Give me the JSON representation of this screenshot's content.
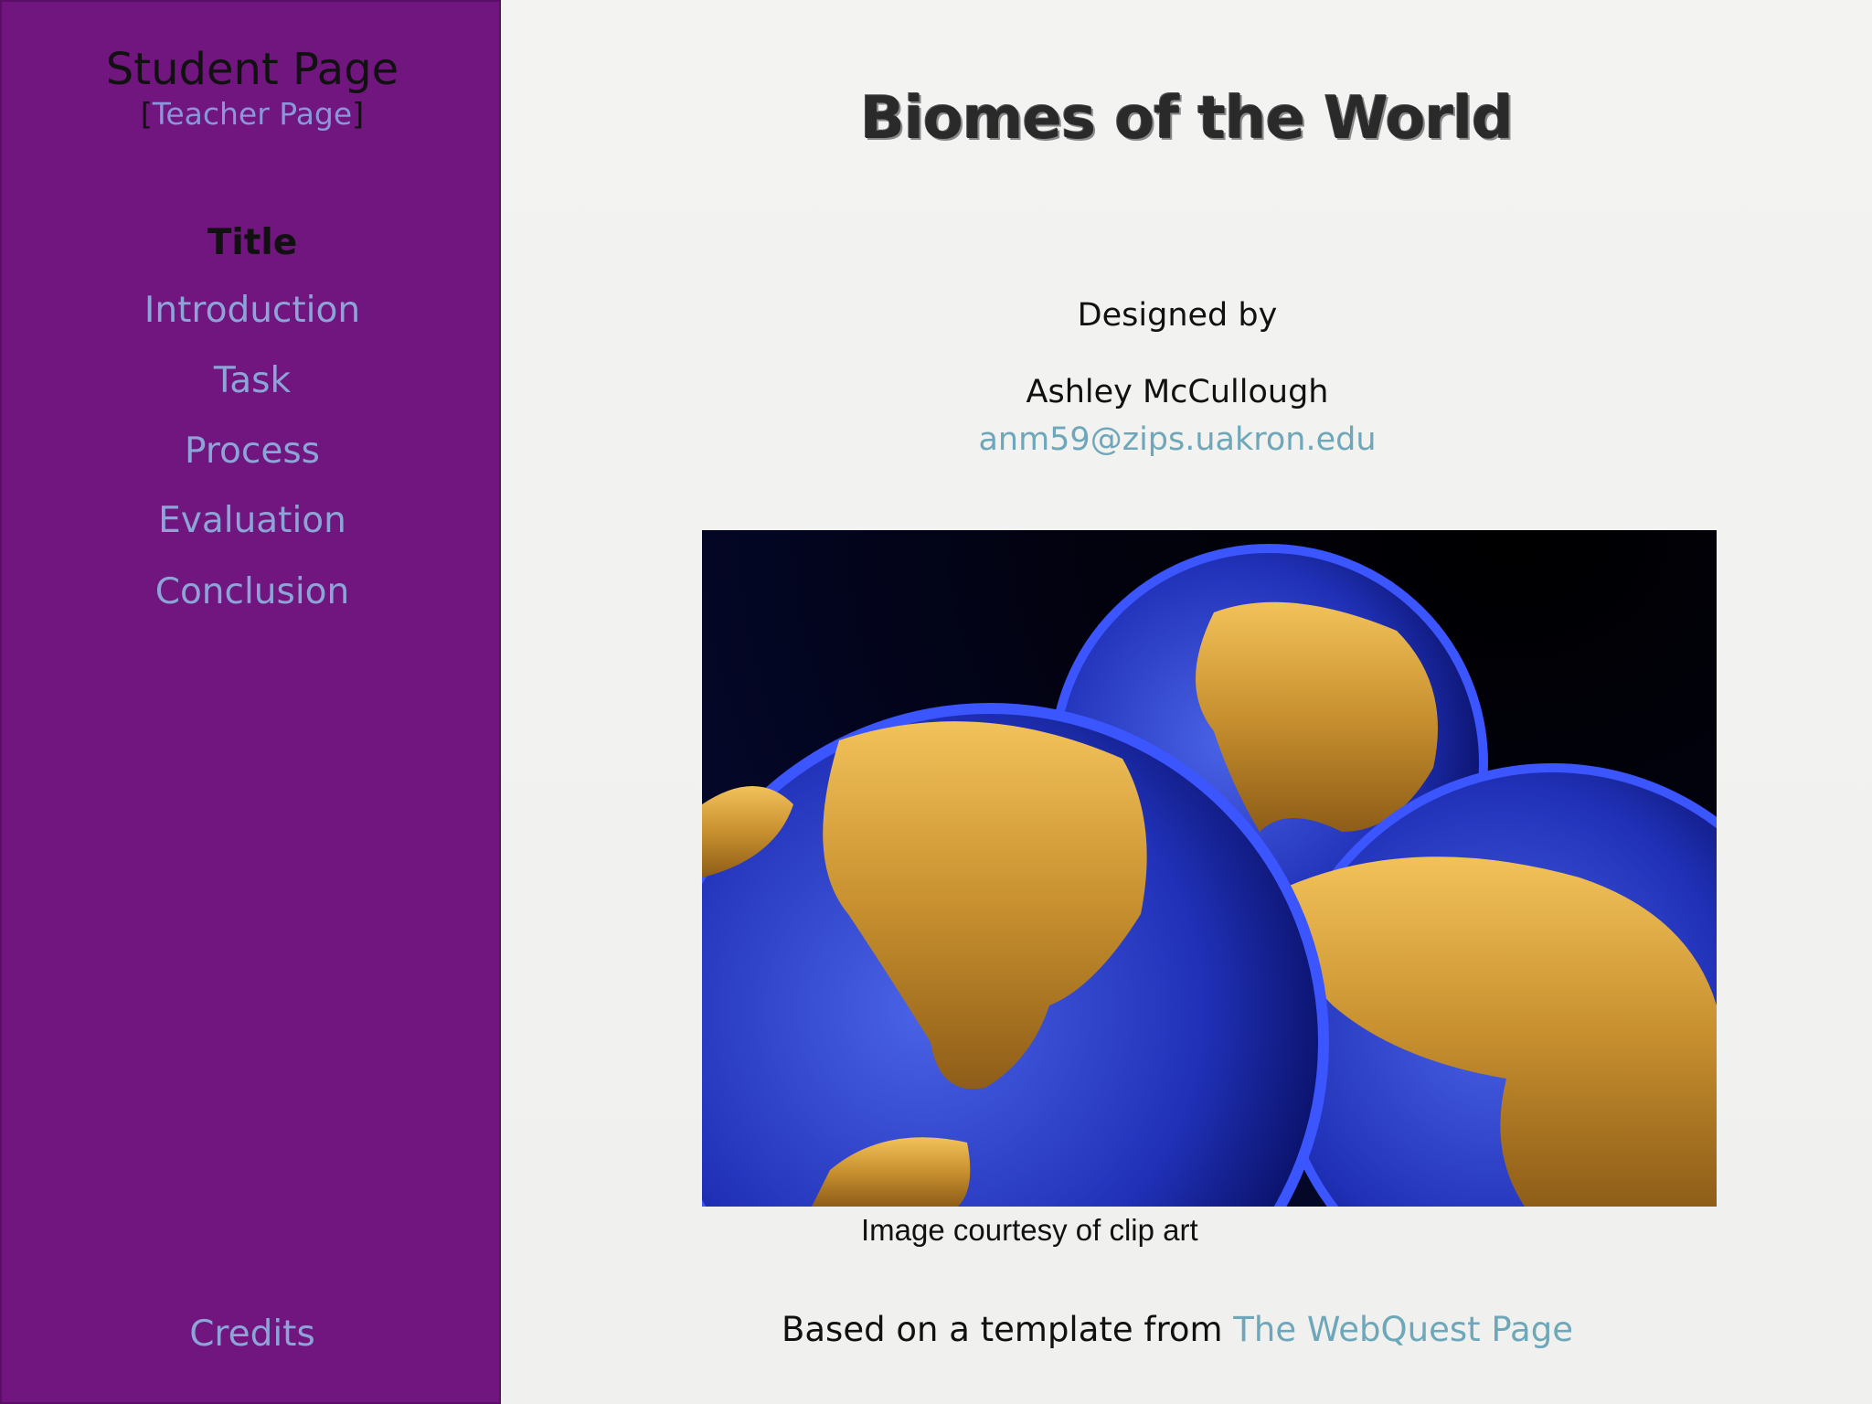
{
  "sidebar": {
    "student_page": "Student Page",
    "teacher_open": "[",
    "teacher_link": "Teacher Page",
    "teacher_close": "]",
    "nav": [
      "Title",
      "Introduction",
      "Task",
      "Process",
      "Evaluation",
      "Conclusion"
    ],
    "active_item": "Title",
    "credits": "Credits"
  },
  "main": {
    "title": "Biomes of the World",
    "designed_by": "Designed by",
    "author": "Ashley McCullough",
    "email": "anm59@zips.uakron.edu",
    "image_icon": "globe-illustration",
    "caption": "Image courtesy of clip art",
    "footer_prefix": "Based on a template from ",
    "footer_link": "The WebQuest Page"
  },
  "colors": {
    "sidebar_bg": "#70167e",
    "nav_link": "#8ca4d8",
    "teacher_link": "#8b95dc",
    "body_link": "#6ea7b9"
  }
}
